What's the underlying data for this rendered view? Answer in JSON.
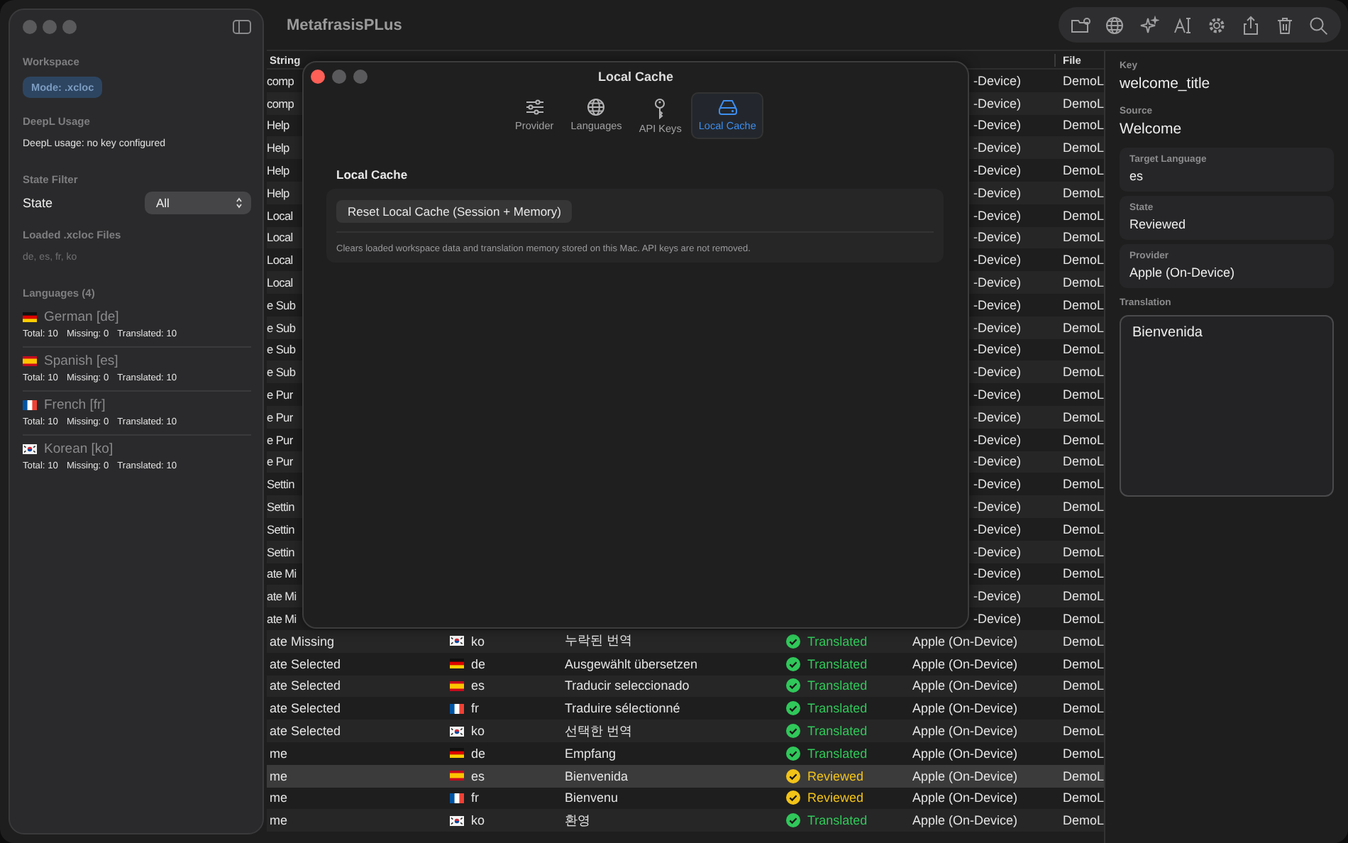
{
  "window": {
    "title": "MetafrasisPLus"
  },
  "sidebar": {
    "workspace": {
      "heading": "Workspace",
      "mode_badge": "Mode: .xcloc"
    },
    "deepl": {
      "heading": "DeepL Usage",
      "text": "DeepL usage: no key configured"
    },
    "state_filter": {
      "heading": "State Filter",
      "label": "State",
      "value": "All"
    },
    "loaded_files": {
      "heading": "Loaded .xcloc Files",
      "text": "de, es, fr, ko"
    },
    "languages": {
      "heading": "Languages (4)",
      "items": [
        {
          "kind": "german",
          "name": "German [de]",
          "total": "Total: 10",
          "missing": "Missing: 0",
          "translated": "Translated: 10"
        },
        {
          "kind": "spanish",
          "name": "Spanish [es]",
          "total": "Total: 10",
          "missing": "Missing: 0",
          "translated": "Translated: 10"
        },
        {
          "kind": "french",
          "name": "French [fr]",
          "total": "Total: 10",
          "missing": "Missing: 0",
          "translated": "Translated: 10"
        },
        {
          "kind": "korean",
          "name": "Korean [ko]",
          "total": "Total: 10",
          "missing": "Missing: 0",
          "translated": "Translated: 10"
        }
      ]
    }
  },
  "table": {
    "columns": {
      "string": "String",
      "file": "File"
    },
    "covered_rows": [
      {
        "string": "comp",
        "provider": "-Device)",
        "file": "DemoL"
      },
      {
        "string": "comp",
        "provider": "-Device)",
        "file": "DemoL"
      },
      {
        "string": "Help",
        "provider": "-Device)",
        "file": "DemoL"
      },
      {
        "string": "Help",
        "provider": "-Device)",
        "file": "DemoL"
      },
      {
        "string": "Help",
        "provider": "-Device)",
        "file": "DemoL"
      },
      {
        "string": "Help",
        "provider": "-Device)",
        "file": "DemoL"
      },
      {
        "string": "Local",
        "provider": "-Device)",
        "file": "DemoL"
      },
      {
        "string": "Local",
        "provider": "-Device)",
        "file": "DemoL"
      },
      {
        "string": "Local",
        "provider": "-Device)",
        "file": "DemoL"
      },
      {
        "string": "Local",
        "provider": "-Device)",
        "file": "DemoL"
      },
      {
        "string": "e Sub",
        "provider": "-Device)",
        "file": "DemoL"
      },
      {
        "string": "e Sub",
        "provider": "-Device)",
        "file": "DemoL"
      },
      {
        "string": "e Sub",
        "provider": "-Device)",
        "file": "DemoL"
      },
      {
        "string": "e Sub",
        "provider": "-Device)",
        "file": "DemoL"
      },
      {
        "string": "e Pur",
        "provider": "-Device)",
        "file": "DemoL"
      },
      {
        "string": "e Pur",
        "provider": "-Device)",
        "file": "DemoL"
      },
      {
        "string": "e Pur",
        "provider": "-Device)",
        "file": "DemoL"
      },
      {
        "string": "e Pur",
        "provider": "-Device)",
        "file": "DemoL"
      },
      {
        "string": "Settin",
        "provider": "-Device)",
        "file": "DemoL"
      },
      {
        "string": "Settin",
        "provider": "-Device)",
        "file": "DemoL"
      },
      {
        "string": "Settin",
        "provider": "-Device)",
        "file": "DemoL"
      },
      {
        "string": "Settin",
        "provider": "-Device)",
        "file": "DemoL"
      },
      {
        "string": "ate Mi",
        "provider": "-Device)",
        "file": "DemoL"
      },
      {
        "string": "ate Mi",
        "provider": "-Device)",
        "file": "DemoL"
      },
      {
        "string": "ate Mi",
        "provider": "-Device)",
        "file": "DemoL"
      }
    ],
    "rows": [
      {
        "kind": "korean",
        "string": "ate Missing",
        "language": "ko",
        "translation": "누락된 번역",
        "state": "Translated",
        "color": "#30c85a",
        "provider": "Apple (On-Device)",
        "file": "DemoL",
        "selected": false
      },
      {
        "kind": "german",
        "string": "ate Selected",
        "language": "de",
        "translation": "Ausgewählt übersetzen",
        "state": "Translated",
        "color": "#30c85a",
        "provider": "Apple (On-Device)",
        "file": "DemoL",
        "selected": false
      },
      {
        "kind": "spanish",
        "string": "ate Selected",
        "language": "es",
        "translation": "Traducir seleccionado",
        "state": "Translated",
        "color": "#30c85a",
        "provider": "Apple (On-Device)",
        "file": "DemoL",
        "selected": false
      },
      {
        "kind": "french",
        "string": "ate Selected",
        "language": "fr",
        "translation": "Traduire sélectionné",
        "state": "Translated",
        "color": "#30c85a",
        "provider": "Apple (On-Device)",
        "file": "DemoL",
        "selected": false
      },
      {
        "kind": "korean",
        "string": "ate Selected",
        "language": "ko",
        "translation": "선택한 번역",
        "state": "Translated",
        "color": "#30c85a",
        "provider": "Apple (On-Device)",
        "file": "DemoL",
        "selected": false
      },
      {
        "kind": "german",
        "string": "me",
        "language": "de",
        "translation": "Empfang",
        "state": "Translated",
        "color": "#30c85a",
        "provider": "Apple (On-Device)",
        "file": "DemoL",
        "selected": false
      },
      {
        "kind": "spanish",
        "string": "me",
        "language": "es",
        "translation": "Bienvenida",
        "state": "Reviewed",
        "color": "#f2c318",
        "provider": "Apple (On-Device)",
        "file": "DemoL",
        "selected": true
      },
      {
        "kind": "french",
        "string": "me",
        "language": "fr",
        "translation": "Bienvenu",
        "state": "Reviewed",
        "color": "#f2c318",
        "provider": "Apple (On-Device)",
        "file": "DemoL",
        "selected": false
      },
      {
        "kind": "korean",
        "string": "me",
        "language": "ko",
        "translation": "환영",
        "state": "Translated",
        "color": "#30c85a",
        "provider": "Apple (On-Device)",
        "file": "DemoL",
        "selected": false
      }
    ]
  },
  "inspector": {
    "key_label": "Key",
    "key": "welcome_title",
    "source_label": "Source",
    "source": "Welcome",
    "fields": [
      {
        "label": "Target Language",
        "value": "es"
      },
      {
        "label": "State",
        "value": "Reviewed"
      },
      {
        "label": "Provider",
        "value": "Apple (On-Device)"
      }
    ],
    "translation_label": "Translation",
    "translation": "Bienvenida"
  },
  "dialog": {
    "title": "Local Cache",
    "tabs": [
      {
        "label": "Provider",
        "selected": false
      },
      {
        "label": "Languages",
        "selected": false
      },
      {
        "label": "API Keys",
        "selected": false
      },
      {
        "label": "Local Cache",
        "selected": true
      }
    ],
    "section_title": "Local Cache",
    "button": "Reset Local Cache (Session + Memory)",
    "note": "Clears loaded workspace data and translation memory stored on this Mac. API keys are not removed."
  }
}
